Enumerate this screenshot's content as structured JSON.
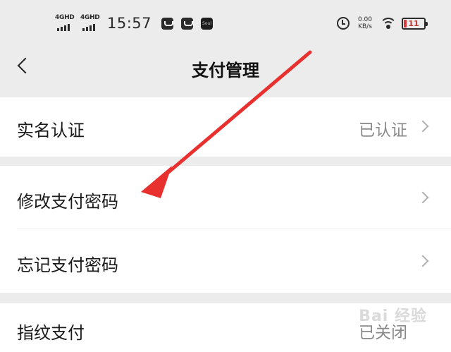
{
  "status_bar": {
    "network_1": "4G",
    "network_1_sup": "HD",
    "network_2": "4G",
    "network_2_sup": "HD",
    "time": "15:57",
    "app_icon_soul": "Soul",
    "speed_value": "0.00",
    "speed_unit": "KB/s",
    "battery_level": "11",
    "battery_color": "#d63a3a"
  },
  "nav": {
    "title": "支付管理"
  },
  "settings": {
    "real_name": {
      "label": "实名认证",
      "value": "已认证"
    },
    "change_password": {
      "label": "修改支付密码"
    },
    "forgot_password": {
      "label": "忘记支付密码"
    },
    "fingerprint": {
      "label": "指纹支付",
      "value": "已关闭"
    }
  },
  "annotation": {
    "arrow_color": "#e8312f"
  },
  "watermark": "Bai 经验"
}
